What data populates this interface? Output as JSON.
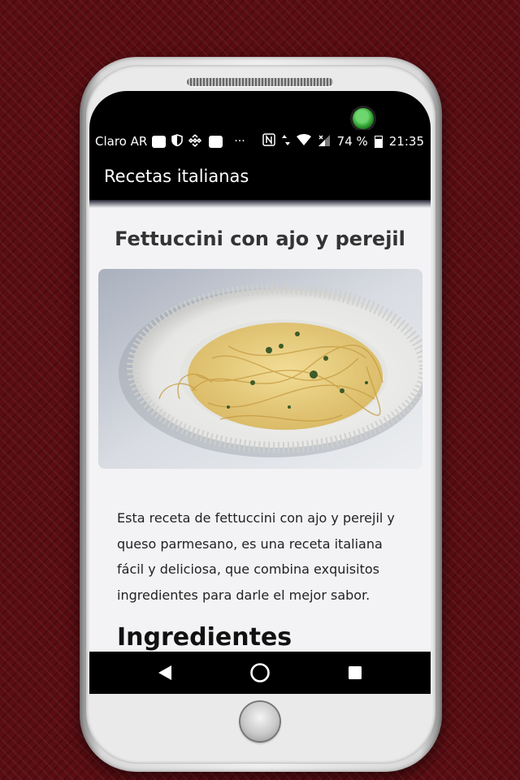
{
  "status_bar": {
    "carrier": "Claro AR",
    "overflow": "···",
    "battery": "74 %",
    "time": "21:35"
  },
  "app_bar": {
    "title": "Recetas italianas"
  },
  "recipe": {
    "title": "Fettuccini con ajo y perejil",
    "intro": "Esta receta de fettuccini con ajo y perejil y queso parmesano, es una receta italiana fácil y deliciosa, que combina exquisitos ingredientes para darle el mejor sabor.",
    "section_heading": "Ingredientes"
  },
  "nav_bar": {
    "back_icon": "triangle-back",
    "home_icon": "circle-home",
    "recent_icon": "square-recents"
  },
  "colors": {
    "background": "#5a0d12",
    "app_bar": "#000000",
    "content_bg": "#f3f3f6"
  }
}
